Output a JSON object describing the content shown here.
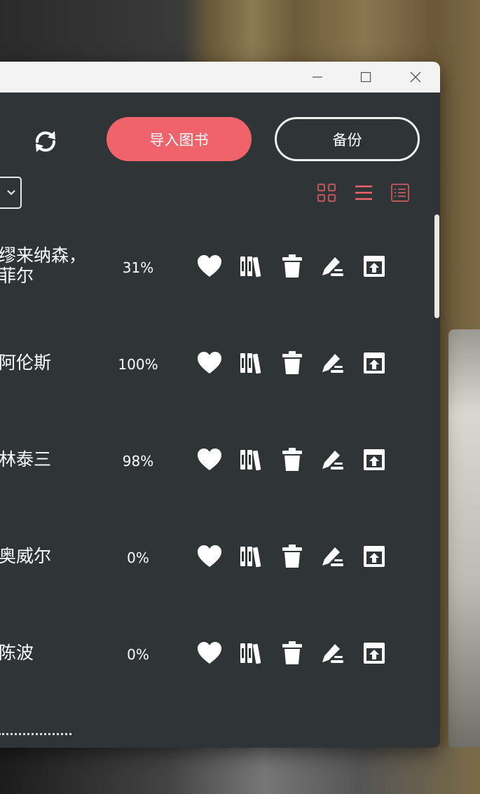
{
  "toolbar": {
    "sync_icon": "sync-icon",
    "import_label": "导入图书",
    "backup_label": "备份"
  },
  "view_modes": [
    {
      "name": "grid-view",
      "active": false
    },
    {
      "name": "list-view",
      "active": true
    },
    {
      "name": "detail-view",
      "active": false
    }
  ],
  "colors": {
    "accent": "#f0636a",
    "window_bg": "#2f3437",
    "text": "#ffffff",
    "inactive_view_icon": "#b5555a"
  },
  "books": [
    {
      "author": "缪来纳森，\n菲尔",
      "progress": "31%"
    },
    {
      "author": "阿伦斯",
      "progress": "100%"
    },
    {
      "author": "林泰三",
      "progress": "98%"
    },
    {
      "author": "奥威尔",
      "progress": "0%"
    },
    {
      "author": "陈波",
      "progress": "0%"
    }
  ],
  "row_actions": [
    "heart-icon",
    "bookshelf-icon",
    "trash-icon",
    "edit-icon",
    "export-icon"
  ]
}
